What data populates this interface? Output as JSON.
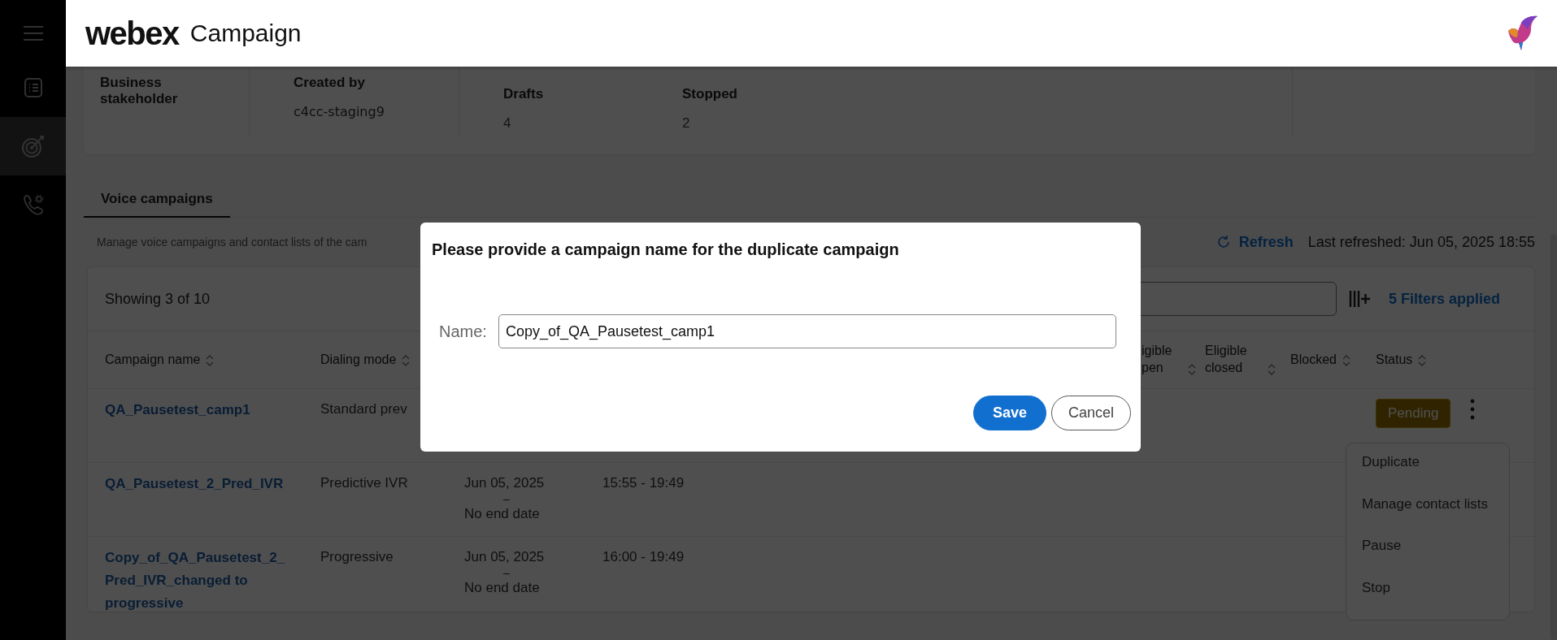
{
  "header": {
    "brand": "webex",
    "product": "Campaign"
  },
  "sidebar": {
    "items": [
      {
        "selected": false
      },
      {
        "selected": true
      },
      {
        "selected": false
      }
    ]
  },
  "summary": {
    "fields": [
      {
        "label": "Business stakeholder"
      },
      {
        "label": "Created by",
        "value": "c4cc-staging9"
      }
    ],
    "stats": [
      {
        "label": "Drafts",
        "value": "4"
      },
      {
        "label": "Stopped",
        "value": "2"
      }
    ]
  },
  "tabs": [
    {
      "label": "Voice campaigns",
      "selected": true
    }
  ],
  "description": "Manage voice campaigns and contact lists of the cam",
  "refresh": {
    "label": "Refresh",
    "last_refreshed": "Last refreshed: Jun 05, 2025 18:55"
  },
  "table": {
    "showing": "Showing 3 of 10",
    "filters": "5 Filters applied",
    "columns": [
      {
        "label": "Campaign name"
      },
      {
        "label": "Dialing mode"
      },
      {
        "label": "igible pen"
      },
      {
        "label": "Eligible closed"
      },
      {
        "label": "Blocked"
      },
      {
        "label": "Status"
      }
    ],
    "rows": [
      {
        "name": "QA_Pausetest_camp1",
        "mode": "Standard prev",
        "status": {
          "label": "Pending",
          "kind": "pending"
        }
      },
      {
        "name": "QA_Pausetest_2_Pred_IVR",
        "mode": "Predictive IVR",
        "start": "Jun 05, 2025",
        "dash": "–",
        "end": "No end date",
        "time": "15:55 - 19:49"
      },
      {
        "name": "Copy_of_QA_Pausetest_2_Pred_IVR_changed to progressive",
        "mode": "Progressive",
        "start": "Jun 05, 2025",
        "dash": "–",
        "end": "No end date",
        "time": "16:00 - 19:49"
      }
    ]
  },
  "row_menu": {
    "items": [
      "Duplicate",
      "Manage contact lists",
      "Pause",
      "Stop"
    ]
  },
  "dialog": {
    "title": "Please provide a campaign name for the duplicate campaign",
    "field_label": "Name:",
    "value": "Copy_of_QA_Pausetest_camp1",
    "buttons": [
      {
        "label": "Save",
        "kind": "primary"
      },
      {
        "label": "Cancel",
        "kind": "secondary"
      }
    ]
  }
}
